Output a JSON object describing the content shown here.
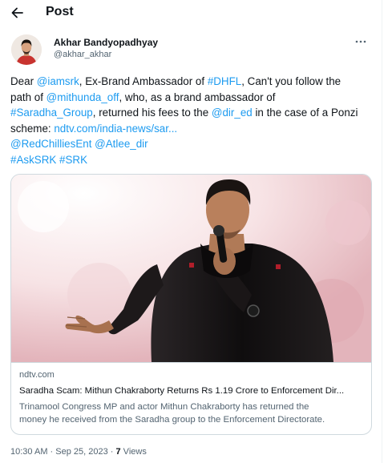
{
  "header": {
    "title": "Post",
    "back_icon": "arrow-left-icon"
  },
  "author": {
    "name": "Akhar Bandyopadhyay",
    "handle": "@akhar_akhar",
    "more_icon": "more-horizontal-icon"
  },
  "tweet": {
    "l1_a": "Dear ",
    "l1_mention": "@iamsrk",
    "l1_b": ", Ex-Brand Ambassador of ",
    "l1_tag": "#DHFL",
    "l1_c": ", Can't you follow the",
    "l2_a": "path of ",
    "l2_mention": "@mithunda_off",
    "l2_b": ", who, as a brand ambassador of",
    "l3_tag": "#Saradha_Group",
    "l3_a": ", returned his fees to the ",
    "l3_mention": "@dir_ed",
    "l3_b": " in the case of a Ponzi",
    "l4_a": "scheme: ",
    "l4_link": "ndtv.com/india-news/sar...",
    "l5_m1": "@RedChilliesEnt",
    "l5_sp": " ",
    "l5_m2": "@Atlee_dir",
    "l6_t1": "#AskSRK",
    "l6_sp": " ",
    "l6_t2": "#SRK"
  },
  "card": {
    "domain": "ndtv.com",
    "title": "Saradha Scam: Mithun Chakraborty Returns Rs 1.19 Crore to Enforcement Dir...",
    "desc_line1": "Trinamool Congress MP and actor Mithun Chakraborty has returned the",
    "desc_line2": "money he received from the Saradha group to the Enforcement Directorate."
  },
  "meta": {
    "time": "10:30 AM",
    "sep1": " · ",
    "date": "Sep 25, 2023",
    "sep2": " · ",
    "views_count": "7",
    "views_label": " Views"
  },
  "colors": {
    "link": "#1d9bf0",
    "text": "#0f1419",
    "secondary": "#536471",
    "border": "#cfd9de"
  }
}
